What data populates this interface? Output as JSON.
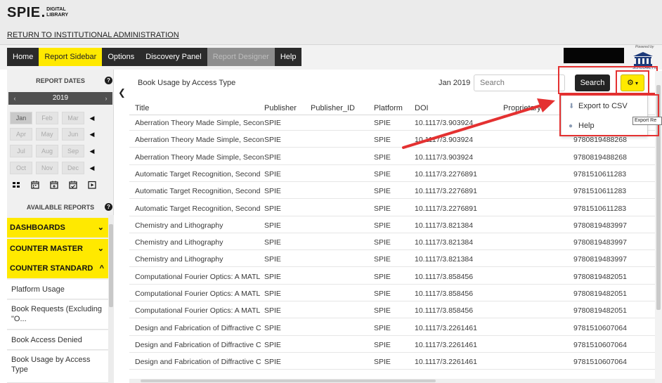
{
  "brand": {
    "logo_main": "SPIE",
    "logo_sub_1": "DIGITAL",
    "logo_sub_2": "LIBRARY",
    "return_link": "RETURN TO INSTITUTIONAL ADMINISTRATION",
    "powered_by": "Powered by",
    "partner": "SCHOLARLY iQ"
  },
  "nav": [
    "Home",
    "Report Sidebar",
    "Options",
    "Discovery Panel",
    "Report Designer",
    "Help"
  ],
  "sidebar": {
    "report_dates_title": "REPORT DATES",
    "year": "2019",
    "months": [
      "Jan",
      "Feb",
      "Mar",
      "Apr",
      "May",
      "Jun",
      "Jul",
      "Aug",
      "Sep",
      "Oct",
      "Nov",
      "Dec"
    ],
    "available_reports_title": "AVAILABLE REPORTS",
    "sections": [
      {
        "label": "DASHBOARDS",
        "chevron": "⌄"
      },
      {
        "label": "COUNTER MASTER",
        "chevron": "⌄"
      },
      {
        "label": "COUNTER STANDARD",
        "chevron": "^"
      }
    ],
    "reports": [
      "Platform Usage",
      "Book Requests (Excluding \"O...",
      "Book Access Denied",
      "Book Usage by Access Type"
    ]
  },
  "main": {
    "report_title": "Book Usage by Access Type",
    "month_label": "Jan 2019",
    "search_placeholder": "Search",
    "search_button": "Search",
    "columns": [
      "Title",
      "Publisher",
      "Publisher_ID",
      "Platform",
      "DOI",
      "Proprietary I"
    ],
    "rows": [
      [
        "Aberration Theory Made Simple, Secon",
        "SPIE",
        "",
        "SPIE",
        "10.1117/3.903924",
        "",
        ""
      ],
      [
        "Aberration Theory Made Simple, Secon",
        "SPIE",
        "",
        "SPIE",
        "10.1117/3.903924",
        "",
        "9780819488268"
      ],
      [
        "Aberration Theory Made Simple, Secon",
        "SPIE",
        "",
        "SPIE",
        "10.1117/3.903924",
        "",
        "9780819488268"
      ],
      [
        "Automatic Target Recognition, Second",
        "SPIE",
        "",
        "SPIE",
        "10.1117/3.2276891",
        "",
        "9781510611283"
      ],
      [
        "Automatic Target Recognition, Second",
        "SPIE",
        "",
        "SPIE",
        "10.1117/3.2276891",
        "",
        "9781510611283"
      ],
      [
        "Automatic Target Recognition, Second",
        "SPIE",
        "",
        "SPIE",
        "10.1117/3.2276891",
        "",
        "9781510611283"
      ],
      [
        "Chemistry and Lithography",
        "SPIE",
        "",
        "SPIE",
        "10.1117/3.821384",
        "",
        "9780819483997"
      ],
      [
        "Chemistry and Lithography",
        "SPIE",
        "",
        "SPIE",
        "10.1117/3.821384",
        "",
        "9780819483997"
      ],
      [
        "Chemistry and Lithography",
        "SPIE",
        "",
        "SPIE",
        "10.1117/3.821384",
        "",
        "9780819483997"
      ],
      [
        "Computational Fourier Optics: A MATL",
        "SPIE",
        "",
        "SPIE",
        "10.1117/3.858456",
        "",
        "9780819482051"
      ],
      [
        "Computational Fourier Optics: A MATL",
        "SPIE",
        "",
        "SPIE",
        "10.1117/3.858456",
        "",
        "9780819482051"
      ],
      [
        "Computational Fourier Optics: A MATL",
        "SPIE",
        "",
        "SPIE",
        "10.1117/3.858456",
        "",
        "9780819482051"
      ],
      [
        "Design and Fabrication of Diffractive C",
        "SPIE",
        "",
        "SPIE",
        "10.1117/3.2261461",
        "",
        "9781510607064"
      ],
      [
        "Design and Fabrication of Diffractive C",
        "SPIE",
        "",
        "SPIE",
        "10.1117/3.2261461",
        "",
        "9781510607064"
      ],
      [
        "Design and Fabrication of Diffractive C",
        "SPIE",
        "",
        "SPIE",
        "10.1117/3.2261461",
        "",
        "9781510607064"
      ]
    ]
  },
  "dropdown": {
    "items": [
      "Export to CSV",
      "Help"
    ],
    "tooltip": "Export Re"
  },
  "colors": {
    "accent_yellow": "#ffe900",
    "nav_dark": "#2b2b2b",
    "highlight_red": "#e43131"
  }
}
